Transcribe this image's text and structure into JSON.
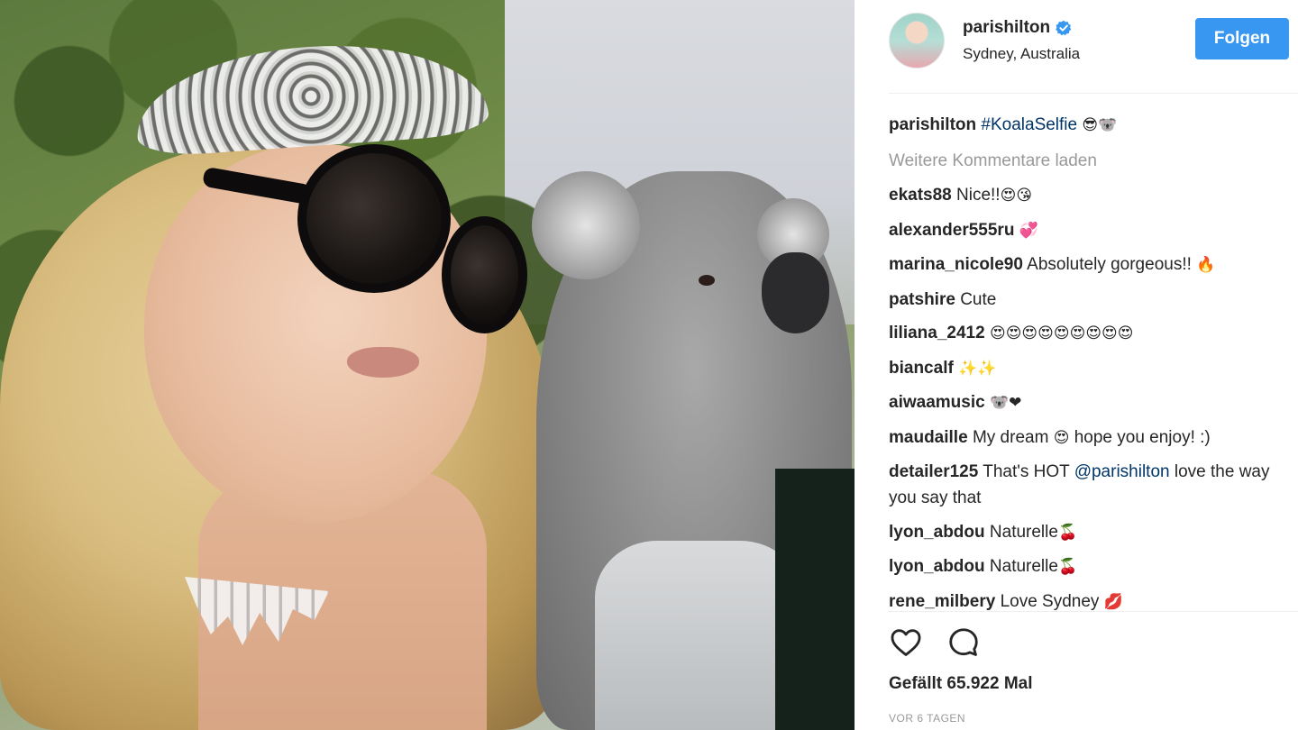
{
  "post": {
    "author": {
      "username": "parishilton",
      "location": "Sydney, Australia"
    },
    "follow_label": "Folgen",
    "caption": {
      "username": "parishilton",
      "hashtag": "#KoalaSelfie",
      "emoji": "😎🐨"
    },
    "load_more_label": "Weitere Kommentare laden",
    "comments": [
      {
        "username": "ekats88",
        "text": "Nice!!",
        "emoji": "😍😘"
      },
      {
        "username": "alexander555ru",
        "text": "",
        "emoji": "💞"
      },
      {
        "username": "marina_nicole90",
        "text": "Absolutely gorgeous!!",
        "emoji": "🔥"
      },
      {
        "username": "patshire",
        "text": "Cute",
        "emoji": ""
      },
      {
        "username": "liliana_2412",
        "text": "",
        "emoji": "😍😍😍😍😍😍😍😍😍"
      },
      {
        "username": "biancalf",
        "text": "",
        "emoji": "✨✨"
      },
      {
        "username": "aiwaamusic",
        "text": "",
        "emoji": "🐨❤"
      },
      {
        "username": "maudaille",
        "text": "My dream",
        "emoji": "😍",
        "text_after": "hope you enjoy! :)"
      },
      {
        "username": "detailer125",
        "text": "That's HOT",
        "mention": "@parishilton",
        "text_after": "love the way you say that"
      },
      {
        "username": "lyon_abdou",
        "text": "Naturelle",
        "emoji": "🍒"
      },
      {
        "username": "lyon_abdou",
        "text": "Naturelle",
        "emoji": "🍒"
      },
      {
        "username": "rene_milbery",
        "text": "Love Sydney",
        "emoji": "💋"
      }
    ],
    "likes": {
      "prefix": "Gefällt",
      "count": "65.922",
      "suffix": "Mal"
    },
    "timestamp": "VOR 6 TAGEN",
    "icons": {
      "like": "heart-icon",
      "comment": "comment-icon",
      "verified": "verified-badge-icon"
    },
    "colors": {
      "follow_button": "#3897f0",
      "link": "#003569",
      "muted": "#999999",
      "verified": "#3897f0"
    }
  }
}
